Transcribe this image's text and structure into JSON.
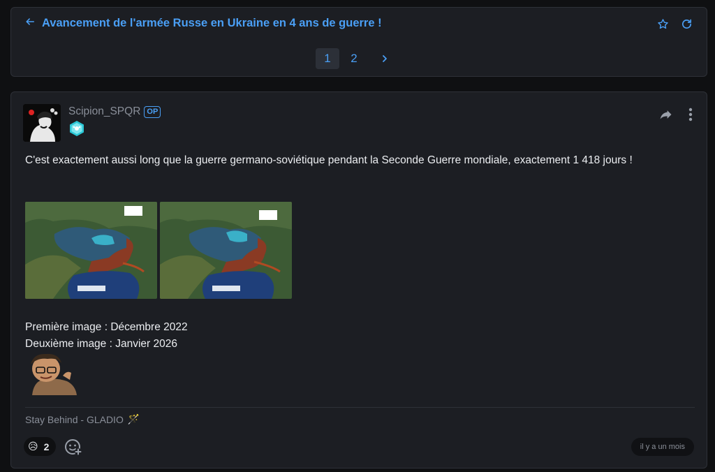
{
  "topic": {
    "title": "Avancement de l'armée Russe en Ukraine en 4 ans de guerre !",
    "back_icon": "arrow-left-icon",
    "favorite_icon": "star-icon",
    "refresh_icon": "refresh-icon"
  },
  "pagination": {
    "pages": [
      "1",
      "2"
    ],
    "current": "1",
    "next_icon": "chevron-right-icon"
  },
  "post": {
    "author": "Scipion_SPQR",
    "op_label": "OP",
    "rank_icon": "rank-badge-icon",
    "share_icon": "share-icon",
    "more_icon": "more-vertical-icon",
    "body": "C'est exactement aussi long que la guerre germano-soviétique pendant la Seconde Guerre mondiale, exactement 1 418 jours !",
    "captions": [
      "Première image : Décembre 2022",
      "Deuxième image : Janvier 2026"
    ],
    "signature": "Stay Behind - GLADIO",
    "signature_emoji": "🪄",
    "reaction": {
      "emoji": "😥",
      "count": "2"
    },
    "add_reaction_icon": "add-reaction-icon",
    "timestamp": "il y a un mois"
  },
  "colors": {
    "accent": "#4a9ff5",
    "card_bg": "#1c1e23",
    "page_bg": "#0f1012",
    "muted": "#8a8f99"
  }
}
